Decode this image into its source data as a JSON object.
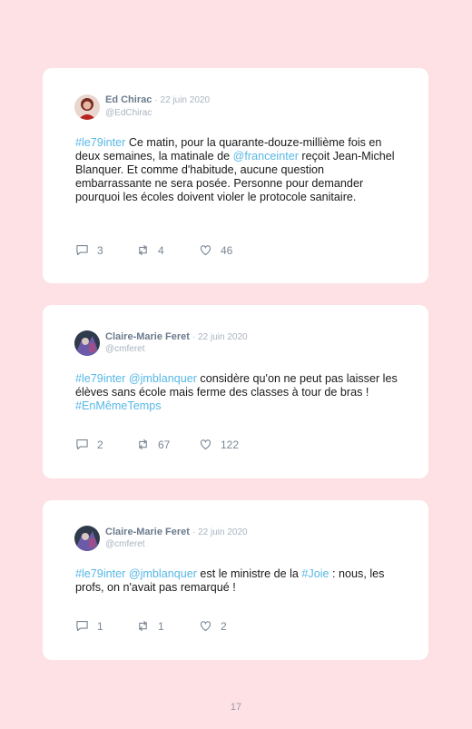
{
  "tweets": [
    {
      "name": "Ed Chirac",
      "date": "· 22 juin 2020",
      "handle": "@EdChirac",
      "body": [
        {
          "t": "#le79inter",
          "link": true
        },
        {
          "t": " Ce matin, pour la quarante-douze-millième fois en deux semaines, la matinale de "
        },
        {
          "t": "@franceinter",
          "link": true
        },
        {
          "t": " reçoit Jean-Michel Blanquer. Et comme d'habitude, aucune question embarrassante ne sera posée. Personne pour demander pourquoi les écoles doivent violer le protocole sanitaire."
        }
      ],
      "replies": "3",
      "retweets": "4",
      "likes": "46"
    },
    {
      "name": "Claire-Marie Feret",
      "date": "· 22 juin 2020",
      "handle": "@cmferet",
      "body": [
        {
          "t": "#le79inter",
          "link": true
        },
        {
          "t": " "
        },
        {
          "t": "@jmblanquer",
          "link": true
        },
        {
          "t": " considère qu'on ne peut pas laisser les élèves sans école mais ferme des classes à tour de bras ! "
        },
        {
          "t": "#EnMêmeTemps",
          "link": true
        }
      ],
      "replies": "2",
      "retweets": "67",
      "likes": "122"
    },
    {
      "name": "Claire-Marie Feret",
      "date": "· 22 juin 2020",
      "handle": "@cmferet",
      "body": [
        {
          "t": "#le79inter",
          "link": true
        },
        {
          "t": " "
        },
        {
          "t": "@jmblanquer",
          "link": true
        },
        {
          "t": " est le ministre de la "
        },
        {
          "t": "#Joie",
          "link": true
        },
        {
          "t": " : nous, les profs, on n'avait pas remarqué !"
        }
      ],
      "replies": "1",
      "retweets": "1",
      "likes": "2"
    }
  ],
  "page_number": "17",
  "colors": {
    "background": "#fde1e5",
    "card": "#ffffff",
    "link": "#57b8e6",
    "name": "#6b7b8c",
    "meta": "#a9b4bf"
  },
  "icons": [
    "reply-icon",
    "retweet-icon",
    "like-icon"
  ]
}
